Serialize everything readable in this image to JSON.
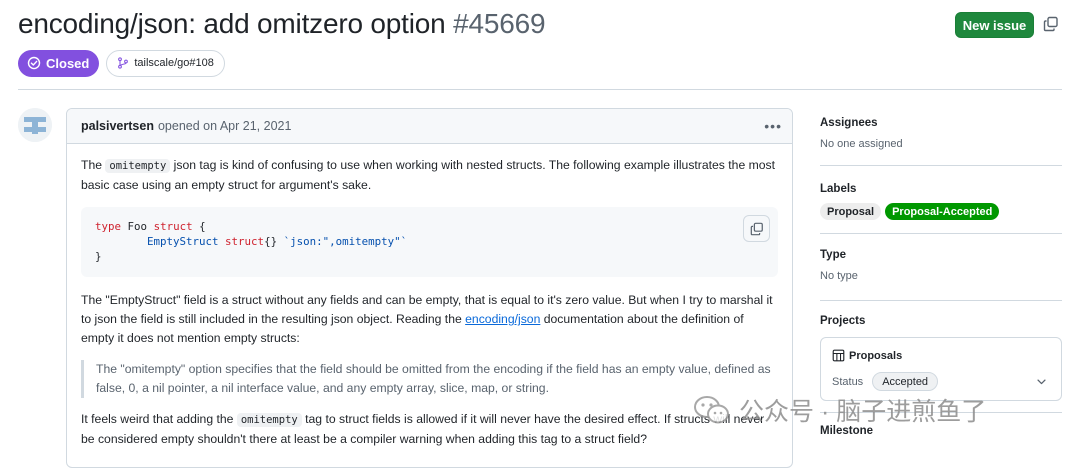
{
  "issue": {
    "title": "encoding/json: add omitzero option",
    "number": "#45669",
    "state": "Closed",
    "reference": "tailscale/go#108"
  },
  "actions": {
    "new_issue": "New issue"
  },
  "comment": {
    "author": "palsivertsen",
    "meta": "opened on Apr 21, 2021",
    "p1_a": "The ",
    "p1_code": "omitempty",
    "p1_b": " json tag is kind of confusing to use when working with nested structs. The following example illustrates the most basic case using an empty struct for argument's sake.",
    "code_lines": [
      "type Foo struct {",
      "        EmptyStruct struct{} `json:\",omitempty\"`",
      "}"
    ],
    "p2_a": "The \"EmptyStruct\" field is a struct without any fields and can be empty, that is equal to it's zero value. But when I try to marshal it to json the field is still included in the resulting json object. Reading the ",
    "p2_link": "encoding/json",
    "p2_b": " documentation about the definition of empty it does not mention empty structs:",
    "quote": "The \"omitempty\" option specifies that the field should be omitted from the encoding if the field has an empty value, defined as false, 0, a nil pointer, a nil interface value, and any empty array, slice, map, or string.",
    "p3_a": "It feels weird that adding the ",
    "p3_code": "omitempty",
    "p3_b": " tag to struct fields is allowed if it will never have the desired effect. If structs will never be considered empty shouldn't there at least be a compiler warning when adding this tag to a struct field?"
  },
  "sidebar": {
    "assignees": {
      "title": "Assignees",
      "value": "No one assigned"
    },
    "labels": {
      "title": "Labels",
      "items": [
        {
          "text": "Proposal",
          "bg": "#ededed",
          "fg": "#1f2328"
        },
        {
          "text": "Proposal-Accepted",
          "bg": "#009800",
          "fg": "#ffffff"
        }
      ]
    },
    "type": {
      "title": "Type",
      "value": "No type"
    },
    "projects": {
      "title": "Projects",
      "project": "Proposals",
      "status_label": "Status",
      "status_value": "Accepted"
    },
    "milestone": {
      "title": "Milestone"
    }
  },
  "watermark": {
    "text": "公众号 · 脑子进煎鱼了"
  },
  "colors": {
    "closed": "#8250df",
    "new_issue": "#1f883d",
    "link": "#0969da"
  }
}
